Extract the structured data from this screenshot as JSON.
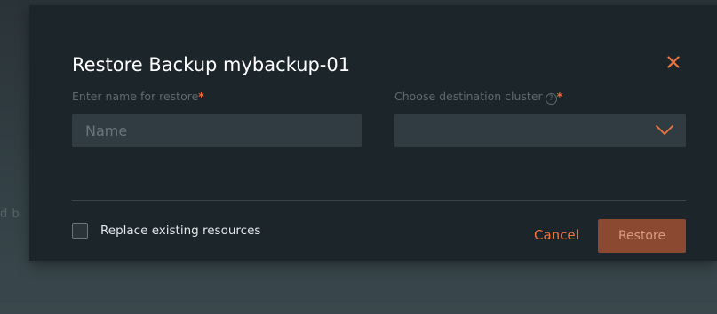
{
  "background": {
    "partial_text": "d b"
  },
  "dialog": {
    "title": "Restore Backup mybackup-01",
    "close_icon": "close-icon",
    "name_field": {
      "label": "Enter name for restore",
      "required_mark": "*",
      "placeholder": "Name",
      "value": ""
    },
    "cluster_field": {
      "label": "Choose destination cluster",
      "help_icon": "question-circle-icon",
      "help_glyph": "?",
      "required_mark": "*",
      "selected": "",
      "dropdown_icon": "chevron-down-icon"
    },
    "replace_checkbox": {
      "label": "Replace existing resources",
      "checked": false
    },
    "buttons": {
      "cancel": "Cancel",
      "restore": "Restore"
    }
  },
  "colors": {
    "accent": "#f0743f",
    "dialog_bg": "#1c2529",
    "field_bg": "#303c41",
    "restore_disabled_bg": "#8a4930"
  }
}
